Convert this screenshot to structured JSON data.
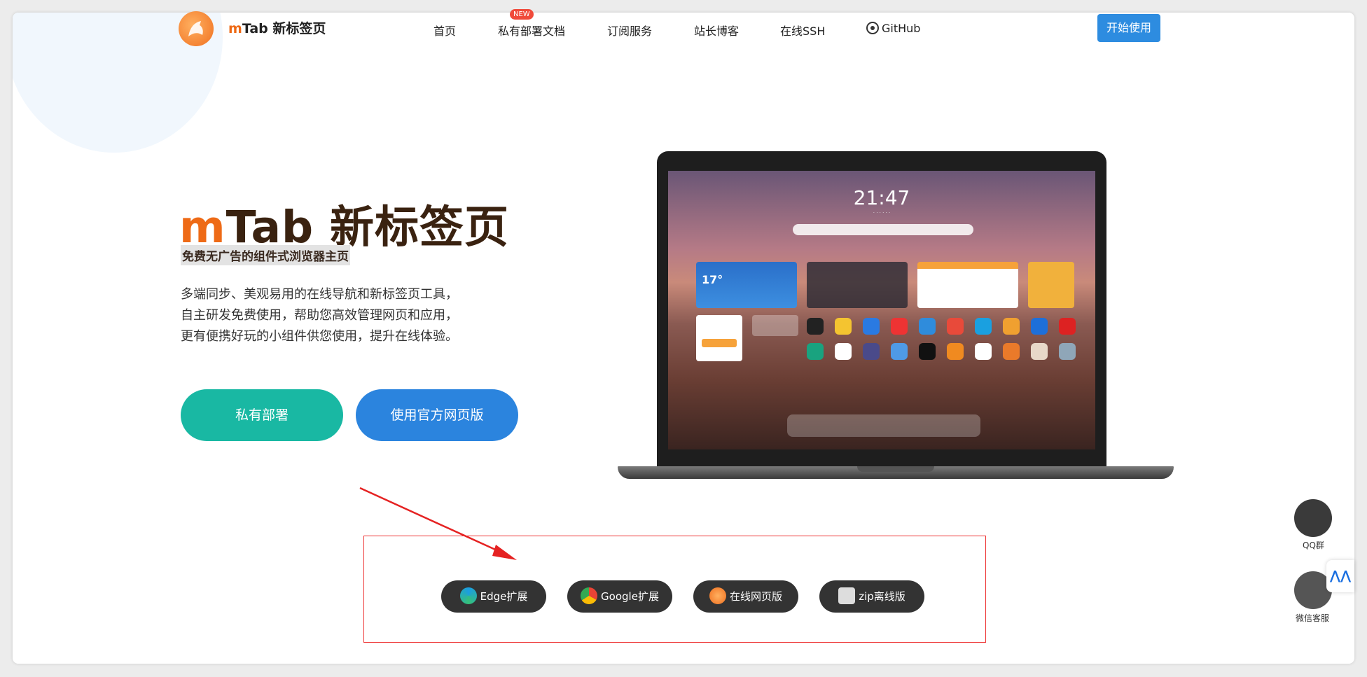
{
  "header": {
    "brand_prefix": "m",
    "brand_rest": "Tab 新标签页",
    "nav": [
      "首页",
      "私有部署文档",
      "订阅服务",
      "站长博客",
      "在线SSH",
      "GitHub"
    ],
    "new_badge": "NEW",
    "start_button": "开始使用"
  },
  "hero": {
    "title_prefix": "m",
    "title_rest": "Tab 新标签页",
    "subtitle": "免费无广告的组件式浏览器主页",
    "desc": [
      "多端同步、美观易用的在线导航和新标签页工具，",
      "自主研发免费使用，帮助您高效管理网页和应用，",
      "更有便携好玩的小组件供您使用，提升在线体验。"
    ],
    "btn_private": "私有部署",
    "btn_official": "使用官方网页版"
  },
  "screen": {
    "time": "21:47",
    "weather_temp": "17°"
  },
  "extensions": [
    {
      "label": "Edge扩展",
      "icon": "edge-icon"
    },
    {
      "label": "Google扩展",
      "icon": "chrome-icon"
    },
    {
      "label": "在线网页版",
      "icon": "mtab-icon"
    },
    {
      "label": "zip离线版",
      "icon": "puzzle-icon"
    }
  ],
  "floating": {
    "qq": "QQ群",
    "wechat": "微信客服",
    "tab_icon": "ai-icon"
  },
  "colors": {
    "accent": "#ee6a16",
    "primary": "#2b84de",
    "teal": "#19b8a3",
    "highlight": "#e33333"
  }
}
